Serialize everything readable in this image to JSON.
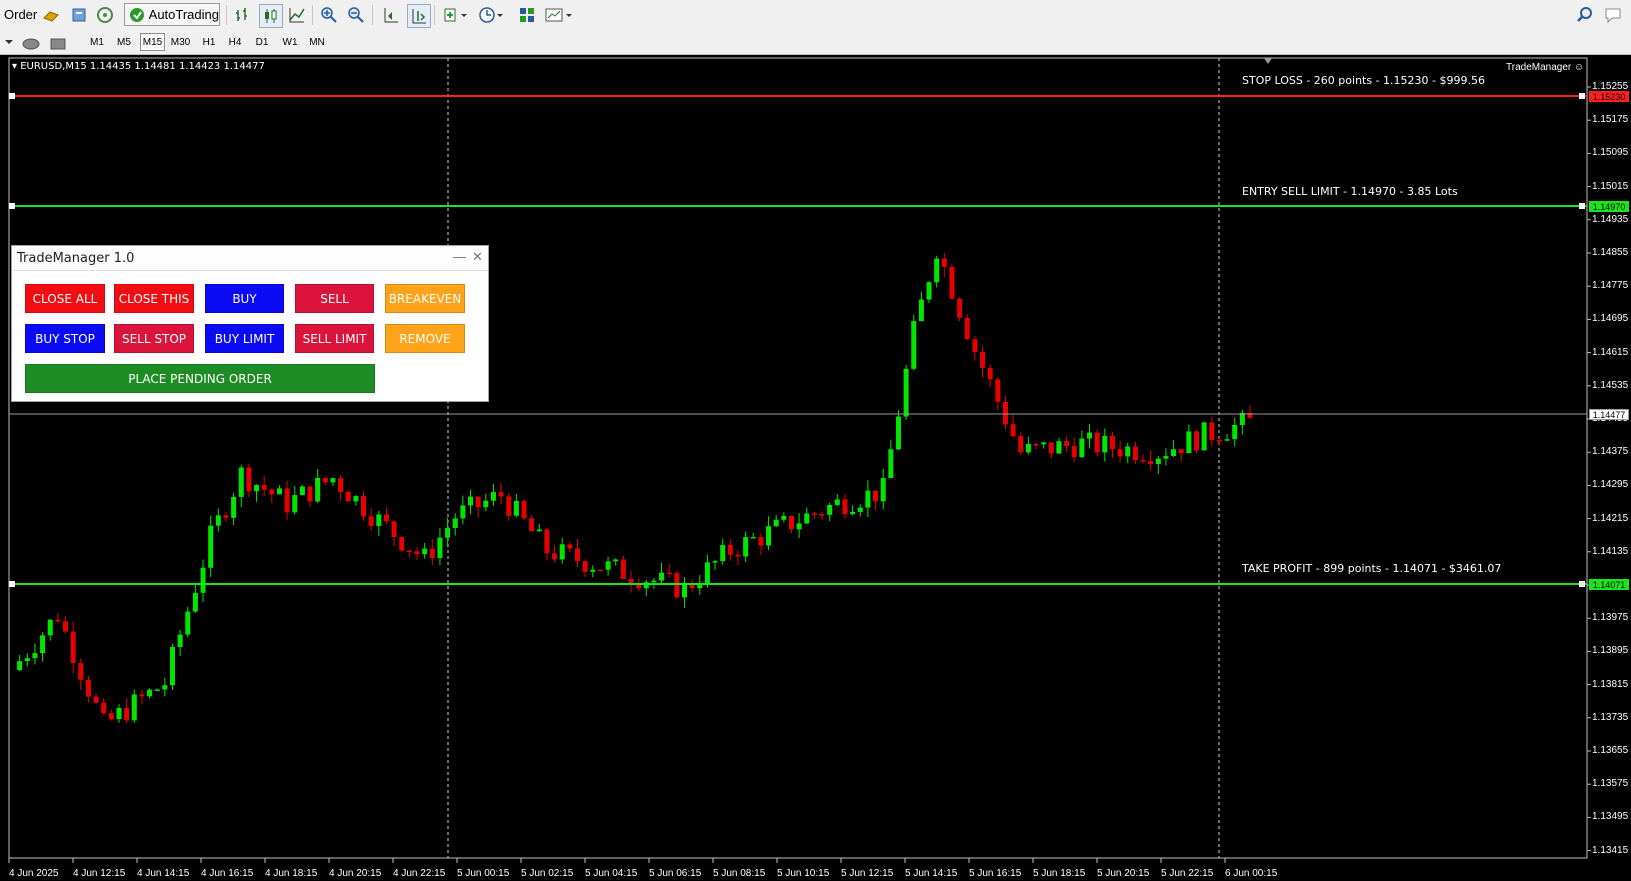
{
  "toolbar": {
    "order_label": "Order",
    "autotrading_label": "AutoTrading",
    "icons": [
      "gold-bars-icon",
      "scripts-icon",
      "signal-icon",
      "autotrading-icon",
      "bar-chart-icon",
      "candlestick-icon",
      "line-chart-icon",
      "zoom-in-icon",
      "zoom-out-icon",
      "chart-shift-icon",
      "autoscroll-icon",
      "indicators-icon",
      "periods-icon",
      "templates-icon",
      "chart-settings-icon",
      "search-icon",
      "chat-icon"
    ]
  },
  "timeframes": [
    "M1",
    "M5",
    "M15",
    "M30",
    "H1",
    "H4",
    "D1",
    "W1",
    "MN"
  ],
  "active_timeframe": "M15",
  "chart": {
    "symbol_line": "EURUSD,M15  1.14435 1.14481 1.14423 1.14477",
    "indicator_label": "TradeManager",
    "stop_loss_note": "STOP LOSS - 260 points - 1.15230 - $999.56",
    "entry_note": "ENTRY SELL LIMIT - 1.14970 - 3.85 Lots",
    "take_profit_note": "TAKE PROFIT - 899 points - 1.14071 - $3461.07",
    "price_ticks": [
      "1.15255",
      "1.15175",
      "1.15095",
      "1.15015",
      "1.14935",
      "1.14855",
      "1.14775",
      "1.14695",
      "1.14615",
      "1.14535",
      "1.14455",
      "1.14375",
      "1.14295",
      "1.14215",
      "1.14135",
      "1.14055",
      "1.13975",
      "1.13895",
      "1.13815",
      "1.13735",
      "1.13655",
      "1.13575",
      "1.13495",
      "1.13415"
    ],
    "time_ticks": [
      "4 Jun 2025",
      "4 Jun 12:15",
      "4 Jun 14:15",
      "4 Jun 16:15",
      "4 Jun 18:15",
      "4 Jun 20:15",
      "4 Jun 22:15",
      "5 Jun 00:15",
      "5 Jun 02:15",
      "5 Jun 04:15",
      "5 Jun 06:15",
      "5 Jun 08:15",
      "5 Jun 10:15",
      "5 Jun 12:15",
      "5 Jun 14:15",
      "5 Jun 16:15",
      "5 Jun 18:15",
      "5 Jun 20:15",
      "5 Jun 22:15",
      "6 Jun 00:15"
    ],
    "stop_loss_price": "1.15230",
    "entry_price": "1.14970",
    "take_profit_price": "1.14071",
    "current_price": "1.14477",
    "colors": {
      "stop_loss": "#ff1f1f",
      "entry": "#19e619",
      "take_profit": "#19e619",
      "bull": "#00e600",
      "bear": "#e60000",
      "background": "#000000"
    }
  },
  "trade_manager": {
    "title": "TradeManager 1.0",
    "minimize_glyph": "—",
    "close_glyph": "✕",
    "buttons": {
      "close_all": "CLOSE ALL",
      "close_this": "CLOSE THIS",
      "buy": "BUY",
      "sell": "SELL",
      "breakeven": "BREAKEVEN",
      "buy_stop": "BUY STOP",
      "sell_stop": "SELL STOP",
      "buy_limit": "BUY LIMIT",
      "sell_limit": "SELL LIMIT",
      "remove": "REMOVE",
      "place_pending": "PLACE PENDING ORDER"
    },
    "colors": {
      "red": "#f20d12",
      "crimson": "#dc143c",
      "blue": "#0a0af5",
      "orange": "#ffa31a",
      "green": "#1e8c24"
    }
  }
}
